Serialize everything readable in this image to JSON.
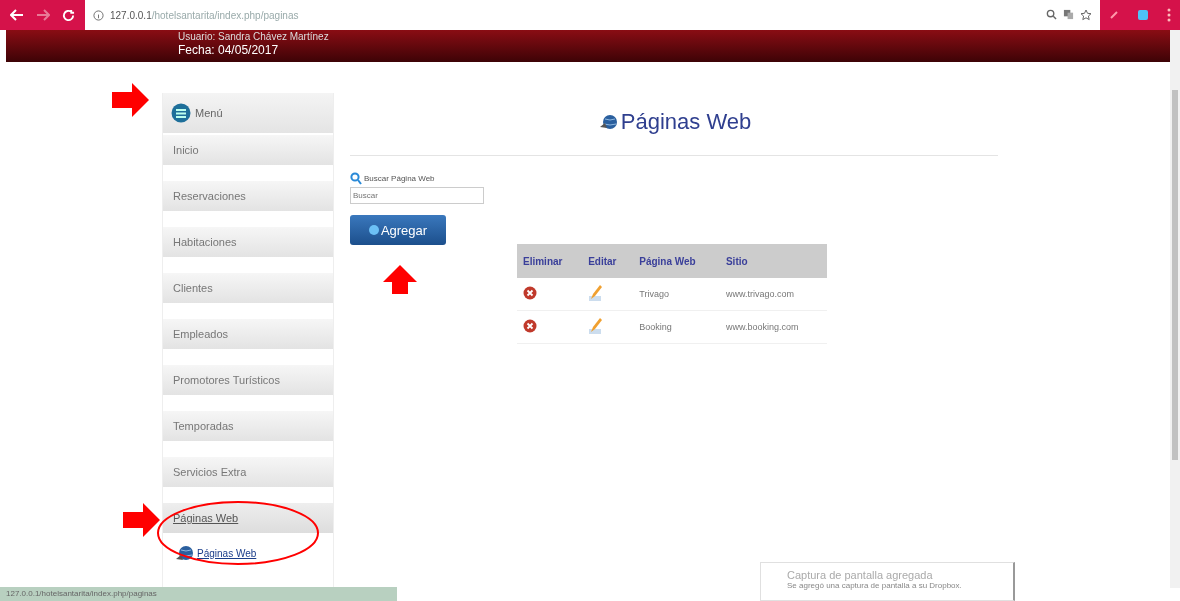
{
  "browser": {
    "url_host": "127.0.0.1",
    "url_path": "/hotelsantarita/index.php/paginas"
  },
  "header": {
    "user": "Usuario: Sandra Chávez Martínez",
    "date": "Fecha: 04/05/2017"
  },
  "sidebar": {
    "title": "Menú",
    "items": [
      {
        "label": "Inicio",
        "selected": false
      },
      {
        "label": "Reservaciones",
        "selected": false
      },
      {
        "label": "Habitaciones",
        "selected": false
      },
      {
        "label": "Clientes",
        "selected": false
      },
      {
        "label": "Empleados",
        "selected": false
      },
      {
        "label": "Promotores Turísticos",
        "selected": false
      },
      {
        "label": "Temporadas",
        "selected": false
      },
      {
        "label": "Servicios Extra",
        "selected": false
      },
      {
        "label": "Páginas Web",
        "selected": true,
        "children": [
          {
            "label": "Páginas Web"
          }
        ]
      }
    ]
  },
  "main": {
    "title": "Páginas Web",
    "search_label": "Buscar Página Web",
    "search": {
      "placeholder": "Buscar"
    },
    "add_button": "Agregar",
    "table": {
      "columns": [
        "Eliminar",
        "Editar",
        "Página Web",
        "Sitio"
      ],
      "rows": [
        {
          "name": "Trivago",
          "site": "www.trivago.com"
        },
        {
          "name": "Booking",
          "site": "www.booking.com"
        }
      ]
    }
  },
  "status_bar": "127.0.0.1/hotelsantarita/index.php/paginas",
  "notification": {
    "title": "Captura de pantalla agregada",
    "text": "Se agregó una captura de pantalla a su Dropbox."
  },
  "annotations": [
    {
      "kind": "arrow"
    },
    {
      "kind": "arrow"
    },
    {
      "kind": "arrow"
    },
    {
      "kind": "ellipse"
    }
  ]
}
